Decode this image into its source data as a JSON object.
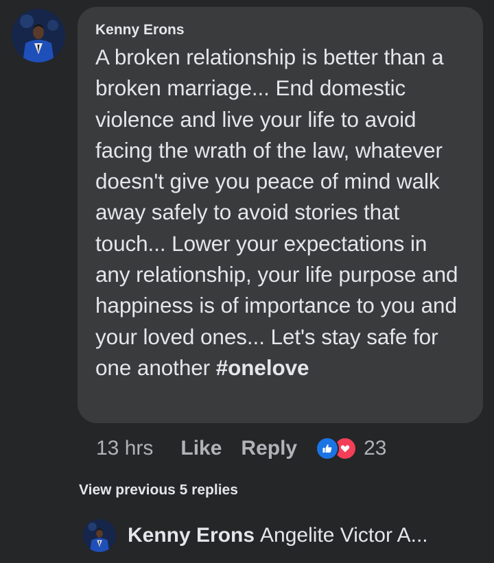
{
  "comment": {
    "author": "Kenny Erons",
    "text": "A broken relationship is better than a broken marriage... End domestic violence and live your life to avoid facing the wrath of the law, whatever doesn't give you peace of mind walk away safely to avoid stories that touch... Lower your expectations in any relationship, your life purpose and happiness is of importance to you and your loved ones... Let's stay safe for one another ",
    "hashtag": "#onelove",
    "avatar_icon": "profile-photo"
  },
  "actions": {
    "time": "13 hrs",
    "like_label": "Like",
    "reply_label": "Reply",
    "reaction_icons": [
      "like-icon",
      "love-icon"
    ],
    "reaction_count": "23"
  },
  "view_previous": "View previous 5 replies",
  "reply_preview": {
    "author": "Kenny Erons",
    "snippet": "Angelite Victor A..."
  },
  "colors": {
    "background": "#252628",
    "bubble": "#3a3b3c",
    "text": "#e4e6eb",
    "secondary_text": "#b0b3b8",
    "like_blue": "#1b74e4",
    "love_red": "#f33e58"
  }
}
